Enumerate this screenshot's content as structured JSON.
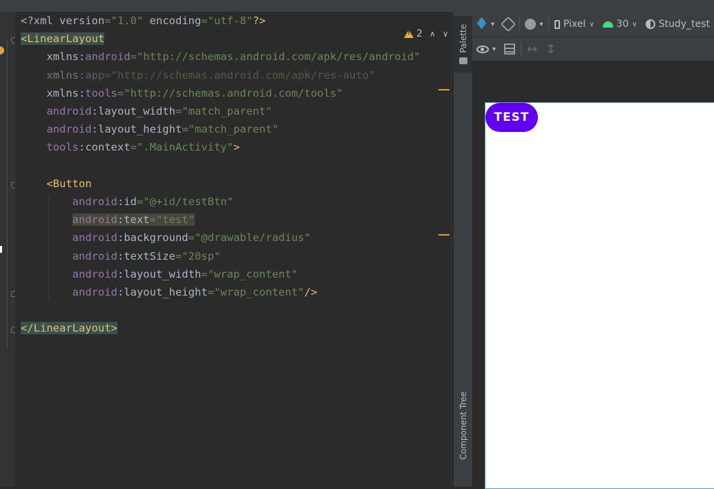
{
  "editor": {
    "lines": [
      [
        {
          "t": "<?xml ",
          "c": "txt"
        },
        {
          "t": "version",
          "c": "txt"
        },
        {
          "t": "=\"1.0\"",
          "c": "str"
        },
        {
          "t": " encoding",
          "c": "txt"
        },
        {
          "t": "=\"utf-8\"",
          "c": "str"
        },
        {
          "t": "?>",
          "c": "tag"
        }
      ],
      [
        {
          "t": "<LinearLayout",
          "c": "tag hl-tag"
        }
      ],
      [
        {
          "t": "    xmlns:",
          "c": "txt"
        },
        {
          "t": "android",
          "c": "ns"
        },
        {
          "t": "=\"http://schemas.android.com/apk/res/android\"",
          "c": "str"
        }
      ],
      [
        {
          "t": "    xmlns:",
          "c": "txt dim"
        },
        {
          "t": "app",
          "c": "ns dim"
        },
        {
          "t": "=\"http://schemas.android.com/apk/res-auto\"",
          "c": "str dim"
        }
      ],
      [
        {
          "t": "    xmlns:",
          "c": "txt"
        },
        {
          "t": "tools",
          "c": "ns"
        },
        {
          "t": "=\"http://schemas.android.com/tools\"",
          "c": "str"
        }
      ],
      [
        {
          "t": "    android",
          "c": "ns"
        },
        {
          "t": ":layout_width",
          "c": "txt"
        },
        {
          "t": "=\"match_parent\"",
          "c": "str"
        }
      ],
      [
        {
          "t": "    android",
          "c": "ns"
        },
        {
          "t": ":layout_height",
          "c": "txt"
        },
        {
          "t": "=\"match_parent\"",
          "c": "str"
        }
      ],
      [
        {
          "t": "    tools",
          "c": "ns"
        },
        {
          "t": ":context",
          "c": "txt"
        },
        {
          "t": "=\".MainActivity\"",
          "c": "str"
        },
        {
          "t": ">",
          "c": "tag"
        }
      ],
      [],
      [
        {
          "t": "    <Button",
          "c": "tag"
        }
      ],
      [
        {
          "t": "        android",
          "c": "ns"
        },
        {
          "t": ":id",
          "c": "txt"
        },
        {
          "t": "=\"@+id/testBtn\"",
          "c": "str"
        }
      ],
      [
        {
          "t": "        ",
          "c": "txt"
        },
        {
          "t": "android",
          "c": "ns hl-attr"
        },
        {
          "t": ":text",
          "c": "txt hl-attr"
        },
        {
          "t": "=\"test\"",
          "c": "str hl-attr"
        }
      ],
      [
        {
          "t": "        android",
          "c": "ns"
        },
        {
          "t": ":background",
          "c": "txt"
        },
        {
          "t": "=\"@drawable/radius\"",
          "c": "str"
        }
      ],
      [
        {
          "t": "        android",
          "c": "ns"
        },
        {
          "t": ":textSize",
          "c": "txt"
        },
        {
          "t": "=\"20sp\"",
          "c": "str"
        }
      ],
      [
        {
          "t": "        android",
          "c": "ns"
        },
        {
          "t": ":layout_width",
          "c": "txt"
        },
        {
          "t": "=\"wrap_content\"",
          "c": "str"
        }
      ],
      [
        {
          "t": "        android",
          "c": "ns"
        },
        {
          "t": ":layout_height",
          "c": "txt"
        },
        {
          "t": "=\"wrap_content\"",
          "c": "str"
        },
        {
          "t": "/>",
          "c": "tag"
        }
      ],
      [],
      [
        {
          "t": "</LinearLayout>",
          "c": "tag hl-tag"
        }
      ]
    ],
    "inspection": {
      "warning_count": "2",
      "prev_icon": "chevron-up-icon",
      "next_icon": "chevron-down-icon"
    }
  },
  "side_tabs": {
    "palette": "Palette",
    "component_tree": "Component Tree"
  },
  "design_toolbar": {
    "device": "Pixel",
    "api_level": "30",
    "theme": "Study_test"
  },
  "preview": {
    "button_text": "TEST",
    "button_color": "#6200ee"
  }
}
